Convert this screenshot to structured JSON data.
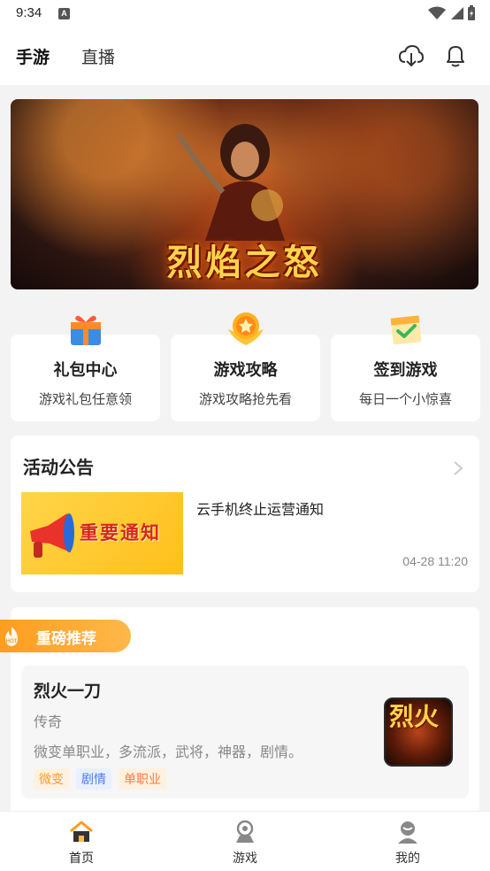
{
  "status_bar": {
    "time": "9:34",
    "notification_icon": "A"
  },
  "header": {
    "tabs": [
      {
        "label": "手游",
        "active": true
      },
      {
        "label": "直播",
        "active": false
      }
    ],
    "icons": [
      "download-icon",
      "bell-icon"
    ]
  },
  "banner": {
    "title": "烈焰之怒"
  },
  "features": [
    {
      "title": "礼包中心",
      "subtitle": "游戏礼包任意领",
      "icon": "gift-icon"
    },
    {
      "title": "游戏攻略",
      "subtitle": "游戏攻略抢先看",
      "icon": "star-badge-icon"
    },
    {
      "title": "签到游戏",
      "subtitle": "每日一个小惊喜",
      "icon": "calendar-check-icon"
    }
  ],
  "activity": {
    "title": "活动公告",
    "thumb_text": "重要通知",
    "headline": "云手机终止运营通知",
    "time": "04-28 11:20"
  },
  "recommend": {
    "badge_label": "重磅推荐",
    "badge_icon_text": "HOT",
    "game": {
      "name": "烈火一刀",
      "genre": "传奇",
      "description": "微变单职业，多流派，武将，神器，剧情。",
      "tags": [
        "微变",
        "剧情",
        "单职业"
      ],
      "icon_text": "烈火"
    }
  },
  "bottom_nav": [
    {
      "label": "首页",
      "active": true,
      "icon": "home-icon"
    },
    {
      "label": "游戏",
      "active": false,
      "icon": "gamepad-icon"
    },
    {
      "label": "我的",
      "active": false,
      "icon": "profile-icon"
    }
  ],
  "colors": {
    "accent": "#ff9d1e",
    "background": "#f3f3f3",
    "card": "#ffffff"
  }
}
